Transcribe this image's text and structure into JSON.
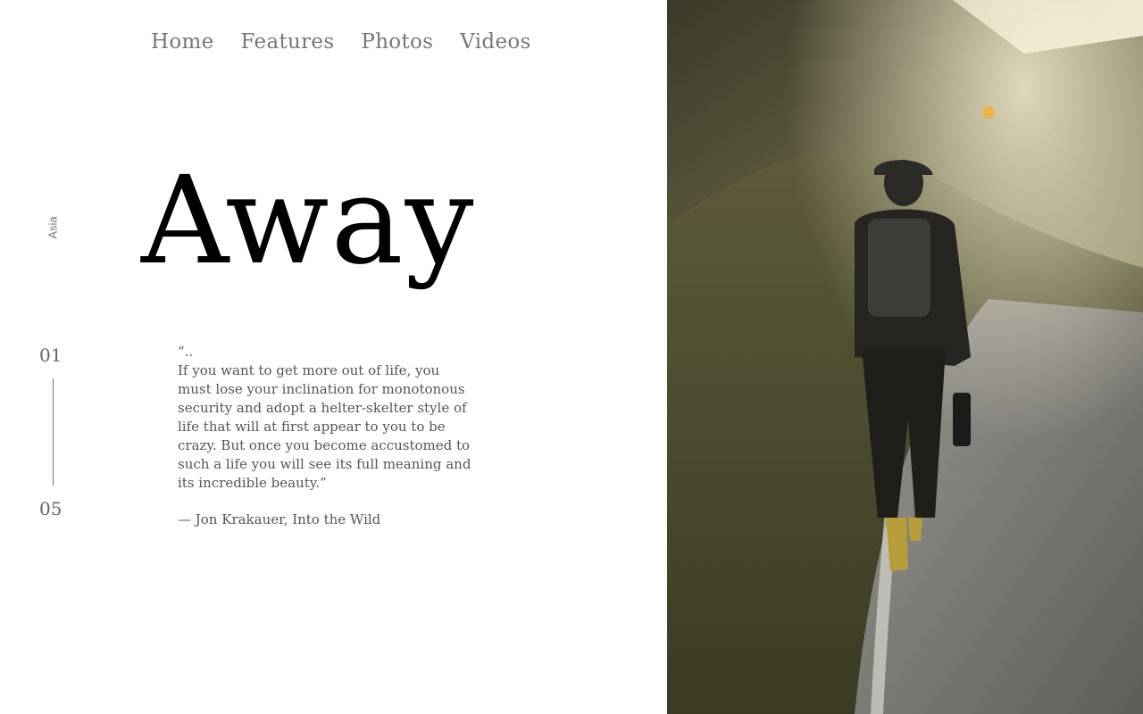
{
  "nav": {
    "items": [
      {
        "label": "Home"
      },
      {
        "label": "Features"
      },
      {
        "label": "Photos"
      },
      {
        "label": "Videos"
      }
    ]
  },
  "region": "Asia",
  "title": "Away",
  "slider": {
    "current": "01",
    "total": "05"
  },
  "quote": {
    "open_mark": "“..",
    "text": "If you want to get more out of life, you must lose your inclination for monotonous security and adopt a helter-skelter style of life that will at first appear to you to be crazy. But once you become accustomed to such a life you will see its full meaning and its incredible beauty.”",
    "attribution": "— Jon Krakauer, Into the Wild"
  },
  "hero_image": {
    "icon": "hiker-on-road-photo"
  }
}
